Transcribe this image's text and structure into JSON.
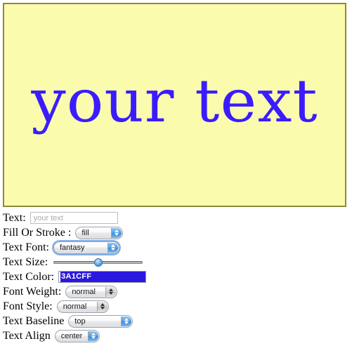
{
  "canvas": {
    "rendered_text": "your text",
    "background_color": "#FBFBAD",
    "border_color": "#8C8C3A",
    "text_color": "#3A1CFF"
  },
  "form": {
    "text": {
      "label": "Text:",
      "value": "",
      "placeholder": "your text"
    },
    "fill_or_stroke": {
      "label": "Fill Or Stroke :",
      "value": "fill"
    },
    "text_font": {
      "label": "Text Font:",
      "value": "fantasy"
    },
    "text_size": {
      "label": "Text Size:",
      "value": "50"
    },
    "text_color": {
      "label": "Text Color:",
      "value": "3A1CFF"
    },
    "font_weight": {
      "label": "Font Weight:",
      "value": "normal"
    },
    "font_style": {
      "label": "Font Style:",
      "value": "normal"
    },
    "text_baseline": {
      "label": "Text Baseline",
      "value": "top"
    },
    "text_align": {
      "label": "Text Align",
      "value": "center"
    }
  }
}
